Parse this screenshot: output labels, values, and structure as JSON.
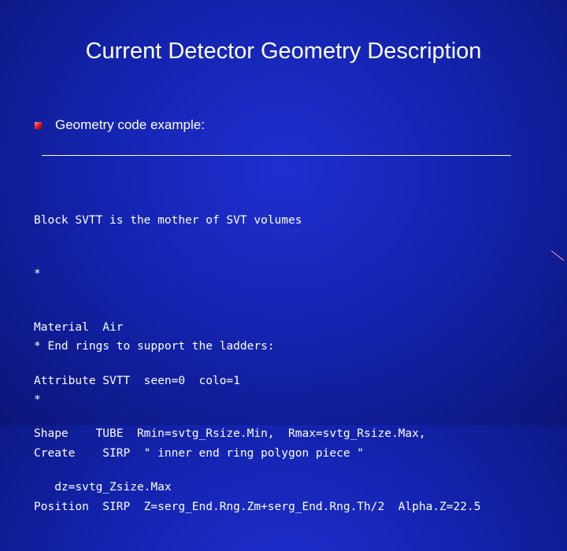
{
  "slide": {
    "title": "Current Detector Geometry Description",
    "bullet": "Geometry code example:",
    "code_block_1": [
      "Block SVTT is the mother of SVT volumes",
      "*",
      "Material  Air",
      "Attribute SVTT  seen=0  colo=1",
      "Shape    TUBE  Rmin=svtg_Rsize.Min,  Rmax=svtg_Rsize.Max,",
      "   dz=svtg_Zsize.Max"
    ],
    "code_block_2": [
      "* End rings to support the ladders:",
      "*",
      "Create    SIRP  \" inner end ring polygon piece \"",
      "Position  SIRP  Z=serg_End.Rng.Zm+serg_End.Rng.Th/2  Alpha.Z=22.5"
    ]
  }
}
